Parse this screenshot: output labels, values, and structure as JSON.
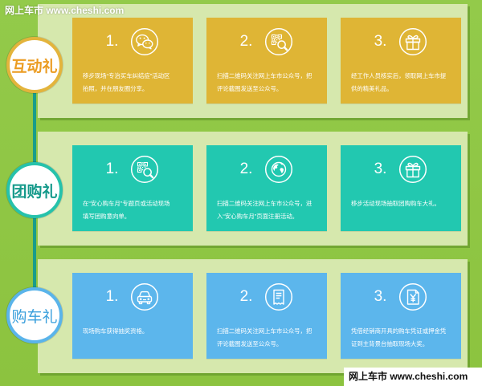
{
  "watermark_top": "网上车市 www.cheshi.com",
  "watermark_bottom": "网上车市 www.cheshi.com",
  "colors": {
    "background": "#8ec641",
    "panel": "#d6e8ad",
    "connector": "#199c8b",
    "card_text": "#ffffff"
  },
  "rows": [
    {
      "label": "互动礼",
      "card_color": "#dfb535",
      "ring_color": "#e3b43c",
      "label_color": "#eb9c22",
      "steps": [
        {
          "number": "1.",
          "icon": "wechat-icon",
          "lines": [
            "移步现场“专治买车纠结症”活动区",
            "拍照，并在朋友圈分享。"
          ]
        },
        {
          "number": "2.",
          "icon": "qr-code-search-icon",
          "lines": [
            "扫描二维码关注网上车市公众号，把",
            "评论截图发送至公众号。"
          ]
        },
        {
          "number": "3.",
          "icon": "gift-icon",
          "lines": [
            "经工作人员核实后，领取网上车市提",
            "供的精美礼品。"
          ]
        }
      ]
    },
    {
      "label": "团购礼",
      "card_color": "#22c8b0",
      "ring_color": "#26c2ab",
      "label_color": "#14998a",
      "steps": [
        {
          "number": "1.",
          "icon": "qr-code-search-icon",
          "lines": [
            "在“安心购车月”专题页或活动现场",
            "填写团购意向单。"
          ]
        },
        {
          "number": "2.",
          "icon": "globe-icon",
          "lines": [
            "扫描二维码关注网上车市公众号，进",
            "入“安心购车月”页面注册活动。"
          ]
        },
        {
          "number": "3.",
          "icon": "gift-icon",
          "lines": [
            "移步活动现场抽取团购购车大礼。"
          ]
        }
      ]
    },
    {
      "label": "购车礼",
      "card_color": "#5cb6ec",
      "ring_color": "#5ab4ea",
      "label_color": "#3a9fdc",
      "steps": [
        {
          "number": "1.",
          "icon": "car-icon",
          "lines": [
            "现场购车获得抽奖资格。"
          ]
        },
        {
          "number": "2.",
          "icon": "receipt-icon",
          "lines": [
            "扫描二维码关注网上车市公众号，把",
            "评论截图发送至公众号。"
          ]
        },
        {
          "number": "3.",
          "icon": "yuan-document-icon",
          "lines": [
            "凭借经销商开具的购车凭证或押金凭",
            "证到主背景台抽取现场大奖。"
          ]
        }
      ]
    }
  ]
}
